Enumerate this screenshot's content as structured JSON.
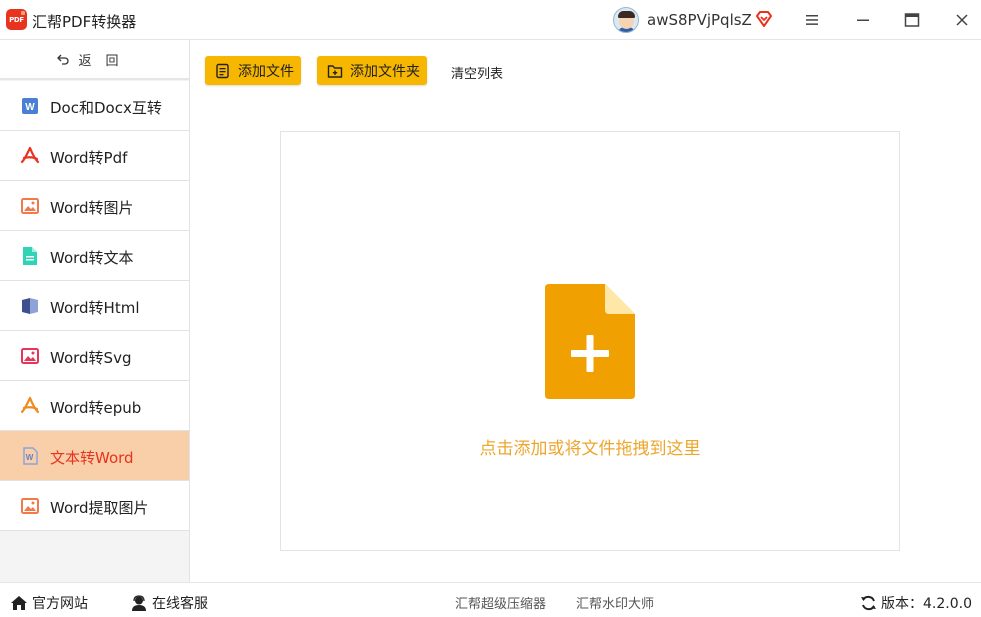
{
  "window": {
    "logo_text": "PDF",
    "title": "汇帮PDF转换器",
    "user_name": "awS8PVjPqlsZ"
  },
  "colors": {
    "accent": "#f7b600",
    "active_bg": "#f8cfa8",
    "active_text": "#e8331e",
    "drop_icon": "#f0a000",
    "drop_text": "#eda62d"
  },
  "sidebar": {
    "back_label": "返回",
    "items": [
      {
        "label": "Doc和Docx互转",
        "icon": "word-doc-icon",
        "active": false
      },
      {
        "label": "Word转Pdf",
        "icon": "acrobat-icon",
        "active": false
      },
      {
        "label": "Word转图片",
        "icon": "image-icon",
        "active": false
      },
      {
        "label": "Word转文本",
        "icon": "text-file-icon",
        "active": false
      },
      {
        "label": "Word转Html",
        "icon": "book-icon",
        "active": false
      },
      {
        "label": "Word转Svg",
        "icon": "svg-image-icon",
        "active": false
      },
      {
        "label": "Word转epub",
        "icon": "epub-icon",
        "active": false
      },
      {
        "label": "文本转Word",
        "icon": "word-outline-icon",
        "active": true
      },
      {
        "label": "Word提取图片",
        "icon": "extract-image-icon",
        "active": false
      }
    ]
  },
  "toolbar": {
    "add_file": "添加文件",
    "add_folder": "添加文件夹",
    "clear_list": "清空列表"
  },
  "dropzone": {
    "hint": "点击添加或将文件拖拽到这里"
  },
  "footer": {
    "website": "官方网站",
    "support": "在线客服",
    "compressor": "汇帮超级压缩器",
    "watermark": "汇帮水印大师",
    "version": "版本：4.2.0.0"
  }
}
